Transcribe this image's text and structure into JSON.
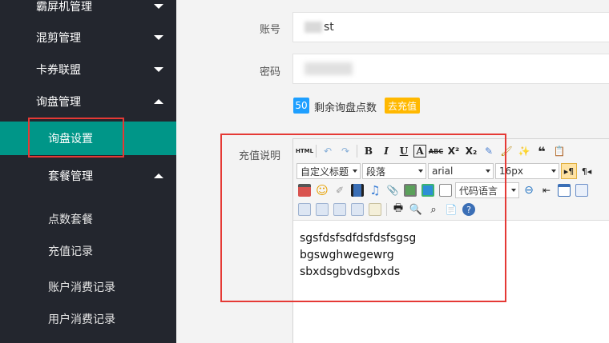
{
  "sidebar": {
    "items": [
      {
        "label": "霸屏机管理"
      },
      {
        "label": "混剪管理"
      },
      {
        "label": "卡券联盟"
      },
      {
        "label": "询盘管理"
      }
    ],
    "sub_items": [
      {
        "label": "询盘设置"
      },
      {
        "label": "套餐管理"
      },
      {
        "label": "点数套餐"
      },
      {
        "label": "充值记录"
      },
      {
        "label": "账户消费记录"
      },
      {
        "label": "用户消费记录"
      }
    ]
  },
  "form": {
    "account_label": "账号",
    "account_value_suffix": "st",
    "password_label": "密码",
    "remaining_count": "50",
    "remaining_text": "剩余询盘点数",
    "recharge_button": "去充值",
    "description_label": "充值说明"
  },
  "editor": {
    "toolbar": {
      "html": "HTML",
      "title_select": "自定义标题",
      "paragraph_select": "段落",
      "font_select": "arial",
      "size_select": "16px",
      "code_select": "代码语言"
    },
    "content": [
      "sgsfdsfsdfdsfdsfsgsg",
      "bgswghwegewrg",
      "sbxdsgbvdsgbxds"
    ]
  },
  "colors": {
    "sidebar_bg": "#23262e",
    "active_bg": "#009688",
    "badge_blue": "#1e9fff",
    "recharge_yellow": "#ffb800",
    "highlight_red": "#e53935"
  }
}
